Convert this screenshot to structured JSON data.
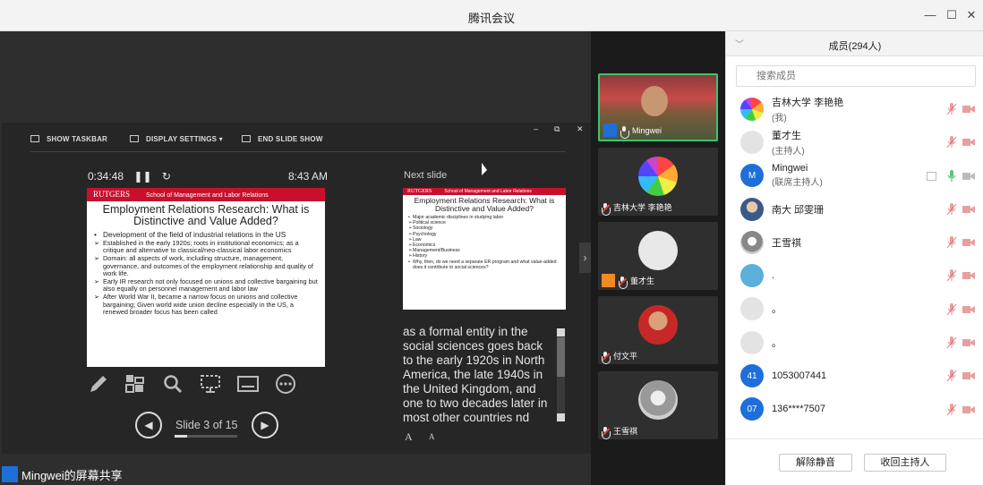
{
  "window": {
    "title": "腾讯会议"
  },
  "presenter": {
    "toolbar": {
      "show_taskbar": "SHOW TASKBAR",
      "display_settings": "DISPLAY SETTINGS ▾",
      "end_slide_show": "END SLIDE SHOW"
    },
    "timer": "0:34:48",
    "clock": "8:43 AM",
    "next_label": "Next slide",
    "slide_counter": "Slide 3 of 15",
    "progress_fraction": 0.2,
    "current_slide": {
      "brand": "RUTGERS",
      "school": "School of Management and Labor Relations",
      "title": "Employment Relations Research: What is Distinctive and Value Added?",
      "bullets": [
        {
          "marker": "•",
          "text": "Development of the field of industrial relations in the US"
        },
        {
          "marker": "➢",
          "text": "Established in the early 1920s; roots in institutional economics; as a critique and alternative to classical/neo-classical labor economics"
        },
        {
          "marker": "➢",
          "text": "Domain: all aspects of work, including structure, management, governance, and outcomes of the employment relationship and quality of work life."
        },
        {
          "marker": "➢",
          "text": "Early IR research not only focused on unions and collective bargaining but also equally on personnel management and labor law"
        },
        {
          "marker": "➢",
          "text": "After World War II, became a narrow focus on unions and collective bargaining; Given world wide union decline especially in the US, a renewed broader focus has been called"
        }
      ]
    },
    "next_slide": {
      "brand": "RUTGERS",
      "school": "School of Management and Labor Relations",
      "title": "Employment Relations Research: What is Distinctive and Value Added?",
      "bullets": [
        {
          "marker": "•",
          "text": "Major academic disciplines in studying labor"
        },
        {
          "marker": "➢",
          "text": "Political science"
        },
        {
          "marker": "➢",
          "text": "Sociology"
        },
        {
          "marker": "➢",
          "text": "Psychology"
        },
        {
          "marker": "➢",
          "text": "Law"
        },
        {
          "marker": "➢",
          "text": "Economics"
        },
        {
          "marker": "➢",
          "text": "Management/Business"
        },
        {
          "marker": "➢",
          "text": "History"
        },
        {
          "marker": "•",
          "text": "Why, then, do we need a separate ER program and what value-added does it contribute to social sciences?"
        }
      ]
    },
    "notes": "as a formal entity in the social sciences goes back to the early 1920s in North America, the late 1940s in the United Kingdom, and one to two decades later in most other countries nd",
    "font_buttons": {
      "increase": "A",
      "decrease": "A"
    }
  },
  "share_label": "Mingwei的屏幕共享",
  "video_tiles": [
    {
      "name": "Mingwei",
      "host": true,
      "muted": false,
      "kind": "camera"
    },
    {
      "name": "吉林大学 李艳艳",
      "host": false,
      "muted": true,
      "kind": "rainbow"
    },
    {
      "name": "董才生",
      "host": true,
      "muted": true,
      "kind": "placeholder"
    },
    {
      "name": "付文平",
      "host": false,
      "muted": true,
      "kind": "photo"
    },
    {
      "name": "王雪祺",
      "host": false,
      "muted": true,
      "kind": "sketch"
    }
  ],
  "members_panel": {
    "title": "成员(294人)",
    "search_placeholder": "搜索成员",
    "members": [
      {
        "name": "吉林大学 李艳艳",
        "role": "(我)",
        "avatar": "rainbow",
        "muted": true,
        "share": false
      },
      {
        "name": "董才生",
        "role": "(主持人)",
        "avatar": "placeholder",
        "muted": true,
        "share": false
      },
      {
        "name": "Mingwei",
        "role": "(联席主持人)",
        "avatar": "M",
        "muted": false,
        "share": true
      },
      {
        "name": "南大 邱雯珊",
        "role": "",
        "avatar": "photo",
        "muted": true,
        "share": false
      },
      {
        "name": "王雪祺",
        "role": "",
        "avatar": "sketch",
        "muted": true,
        "share": false
      },
      {
        "name": ".",
        "role": "",
        "avatar": "totoro",
        "muted": true,
        "share": false
      },
      {
        "name": "。",
        "role": "",
        "avatar": "placeholder",
        "muted": true,
        "share": false
      },
      {
        "name": "。",
        "role": "",
        "avatar": "placeholder",
        "muted": true,
        "share": false
      },
      {
        "name": "1053007441",
        "role": "",
        "avatar": "41",
        "muted": true,
        "share": false
      },
      {
        "name": "136****7507",
        "role": "",
        "avatar": "07",
        "muted": true,
        "share": false
      }
    ],
    "unmute_all": "解除静音",
    "reclaim_host": "收回主持人"
  },
  "colors": {
    "accent": "#1e6fd9",
    "rutgers_red": "#c8102e",
    "muted_red": "#e04646"
  }
}
